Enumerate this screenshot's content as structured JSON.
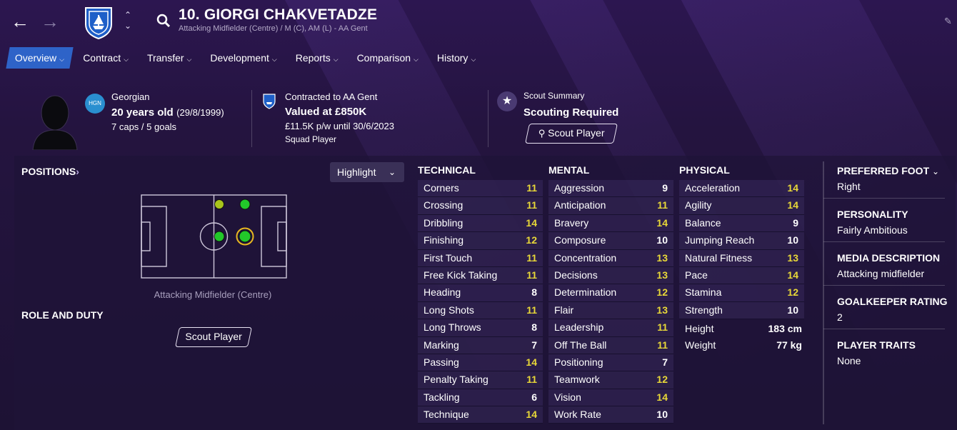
{
  "header": {
    "player_name": "10. GIORGI CHAKVETADZE",
    "player_subtitle": "Attacking Midfielder (Centre) / M (C), AM (L) - AA Gent",
    "icons": [
      "back-arrow-icon",
      "forward-arrow-icon",
      "club-crest-icon",
      "up-down-chevron-icon",
      "search-icon",
      "edit-icon"
    ]
  },
  "tabs": [
    {
      "label": "Overview",
      "active": true
    },
    {
      "label": "Contract"
    },
    {
      "label": "Transfer"
    },
    {
      "label": "Development"
    },
    {
      "label": "Reports"
    },
    {
      "label": "Comparison"
    },
    {
      "label": "History"
    }
  ],
  "summary": {
    "nationality": "Georgian",
    "nation_code": "HGN",
    "age": "20 years old",
    "dob": "(29/8/1999)",
    "caps": "7 caps / 5 goals",
    "contract_line": "Contracted to AA Gent",
    "value": "Valued at £850K",
    "wage": "£11.5K p/w until 30/6/2023",
    "squad_status": "Squad Player",
    "scout_label": "Scout Summary",
    "scout_status": "Scouting Required",
    "scout_button": "Scout Player"
  },
  "positions": {
    "title": "POSITIONS",
    "highlight_label": "Highlight",
    "caption": "Attacking Midfielder (Centre)",
    "role_title": "ROLE AND DUTY",
    "role_button": "Scout Player",
    "colors": {
      "natural": "#22c82a",
      "accomplished": "#a8c41c",
      "highlight_ring": "#e8b820",
      "pitch_lines": "#cfc8dc"
    }
  },
  "technical": {
    "title": "TECHNICAL",
    "rows": [
      {
        "name": "Corners",
        "value": "11"
      },
      {
        "name": "Crossing",
        "value": "11"
      },
      {
        "name": "Dribbling",
        "value": "14"
      },
      {
        "name": "Finishing",
        "value": "12"
      },
      {
        "name": "First Touch",
        "value": "11"
      },
      {
        "name": "Free Kick Taking",
        "value": "11"
      },
      {
        "name": "Heading",
        "value": "8"
      },
      {
        "name": "Long Shots",
        "value": "11"
      },
      {
        "name": "Long Throws",
        "value": "8"
      },
      {
        "name": "Marking",
        "value": "7"
      },
      {
        "name": "Passing",
        "value": "14"
      },
      {
        "name": "Penalty Taking",
        "value": "11"
      },
      {
        "name": "Tackling",
        "value": "6"
      },
      {
        "name": "Technique",
        "value": "14"
      }
    ]
  },
  "mental": {
    "title": "MENTAL",
    "rows": [
      {
        "name": "Aggression",
        "value": "9"
      },
      {
        "name": "Anticipation",
        "value": "11"
      },
      {
        "name": "Bravery",
        "value": "14"
      },
      {
        "name": "Composure",
        "value": "10"
      },
      {
        "name": "Concentration",
        "value": "13"
      },
      {
        "name": "Decisions",
        "value": "13"
      },
      {
        "name": "Determination",
        "value": "12"
      },
      {
        "name": "Flair",
        "value": "13"
      },
      {
        "name": "Leadership",
        "value": "11"
      },
      {
        "name": "Off The Ball",
        "value": "11"
      },
      {
        "name": "Positioning",
        "value": "7"
      },
      {
        "name": "Teamwork",
        "value": "12"
      },
      {
        "name": "Vision",
        "value": "14"
      },
      {
        "name": "Work Rate",
        "value": "10"
      }
    ]
  },
  "physical": {
    "title": "PHYSICAL",
    "rows": [
      {
        "name": "Acceleration",
        "value": "14"
      },
      {
        "name": "Agility",
        "value": "14"
      },
      {
        "name": "Balance",
        "value": "9"
      },
      {
        "name": "Jumping Reach",
        "value": "10"
      },
      {
        "name": "Natural Fitness",
        "value": "13"
      },
      {
        "name": "Pace",
        "value": "14"
      },
      {
        "name": "Stamina",
        "value": "12"
      },
      {
        "name": "Strength",
        "value": "10"
      }
    ],
    "height_label": "Height",
    "height_value": "183 cm",
    "weight_label": "Weight",
    "weight_value": "77 kg"
  },
  "side": {
    "preferred_foot_title": "PREFERRED FOOT",
    "preferred_foot": "Right",
    "personality_title": "PERSONALITY",
    "personality": "Fairly Ambitious",
    "media_title": "MEDIA DESCRIPTION",
    "media": "Attacking midfielder",
    "gk_title": "GOALKEEPER RATING",
    "gk": "2",
    "traits_title": "PLAYER TRAITS",
    "traits": "None"
  },
  "colors": {
    "attr_high": "#e8d838",
    "attr_normal": "#ffffff",
    "tab_active": "#2e63c8"
  }
}
